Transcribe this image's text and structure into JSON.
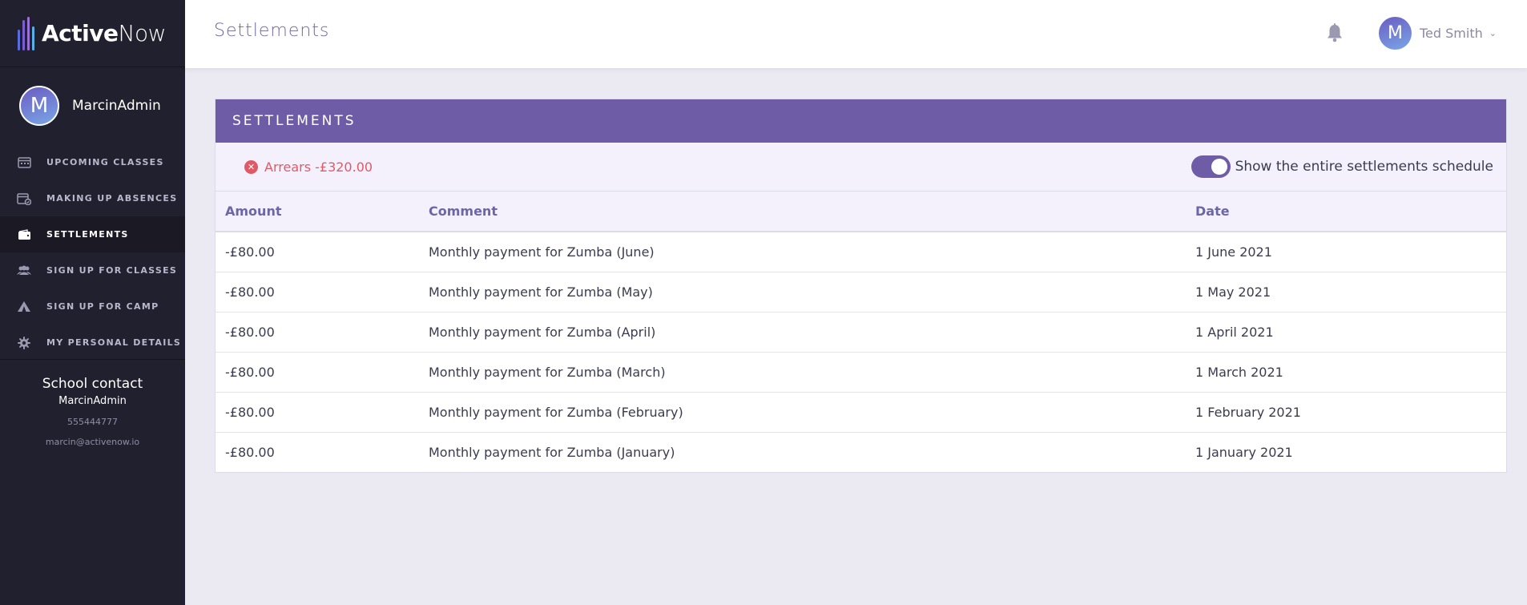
{
  "brand": {
    "name_bold": "Active",
    "name_light": "Now",
    "colors": {
      "bar1": "#5a6be0",
      "bar2": "#7b5fd0",
      "bar3": "#9b6fd8",
      "bar4": "#58b0e8"
    }
  },
  "sidebar": {
    "profile": {
      "initial": "M",
      "name": "MarcinAdmin"
    },
    "items": [
      {
        "label": "UPCOMING CLASSES",
        "icon": "calendar-icon",
        "active": false
      },
      {
        "label": "MAKING UP ABSENCES",
        "icon": "calendar-check-icon",
        "active": false
      },
      {
        "label": "SETTLEMENTS",
        "icon": "wallet-icon",
        "active": true
      },
      {
        "label": "SIGN UP FOR CLASSES",
        "icon": "users-icon",
        "active": false
      },
      {
        "label": "SIGN UP FOR CAMP",
        "icon": "tent-icon",
        "active": false
      },
      {
        "label": "MY PERSONAL DETAILS",
        "icon": "gear-icon",
        "active": false
      }
    ],
    "contact": {
      "title": "School contact",
      "name": "MarcinAdmin",
      "phone": "555444777",
      "email": "marcin@activenow.io"
    }
  },
  "header": {
    "title": "Settlements",
    "user": {
      "initial": "M",
      "name": "Ted Smith"
    }
  },
  "card": {
    "title": "SETTLEMENTS",
    "arrears": "Arrears -£320.00",
    "toggle_label": "Show the entire settlements schedule",
    "toggle_on": true,
    "columns": [
      "Amount",
      "Comment",
      "Date"
    ],
    "rows": [
      {
        "amount": "-£80.00",
        "comment": "Monthly payment for Zumba (June)",
        "date": "1 June 2021"
      },
      {
        "amount": "-£80.00",
        "comment": "Monthly payment for Zumba (May)",
        "date": "1 May 2021"
      },
      {
        "amount": "-£80.00",
        "comment": "Monthly payment for Zumba (April)",
        "date": "1 April 2021"
      },
      {
        "amount": "-£80.00",
        "comment": "Monthly payment for Zumba (March)",
        "date": "1 March 2021"
      },
      {
        "amount": "-£80.00",
        "comment": "Monthly payment for Zumba (February)",
        "date": "1 February 2021"
      },
      {
        "amount": "-£80.00",
        "comment": "Monthly payment for Zumba (January)",
        "date": "1 January 2021"
      }
    ]
  },
  "colors": {
    "accent": "#6f5ca6",
    "sidebar_bg": "#21202e",
    "error": "#e05a65"
  }
}
